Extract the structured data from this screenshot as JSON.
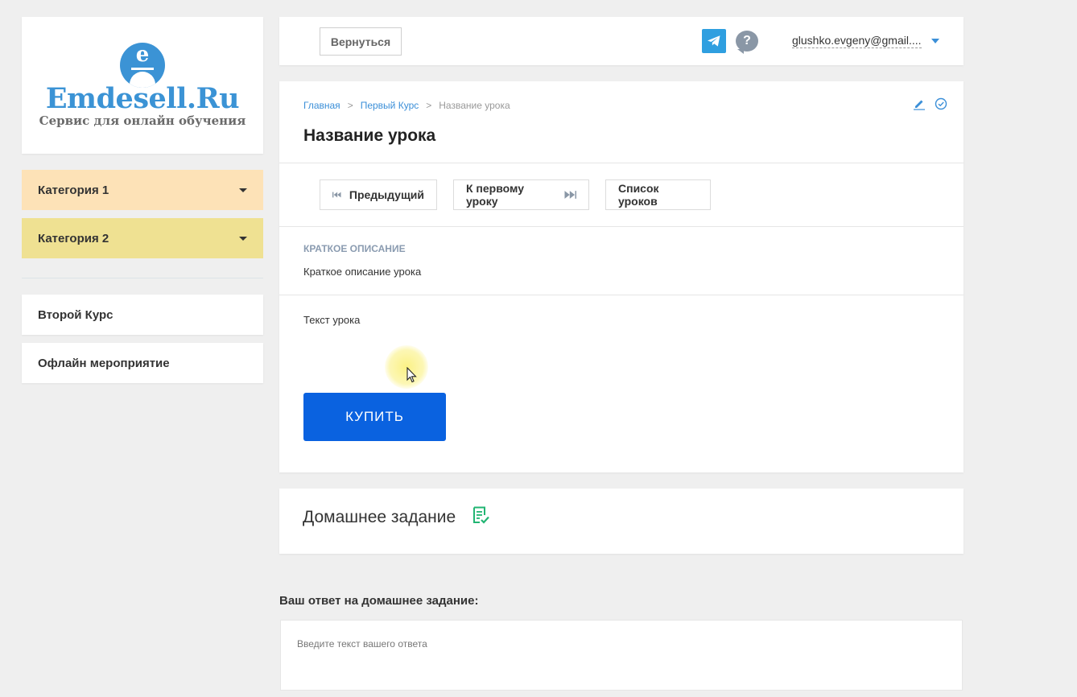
{
  "sidebar": {
    "logo": {
      "title": "Emdesell.Ru",
      "subtitle": "Сервис для онлайн обучения",
      "letter": "e"
    },
    "categories": [
      {
        "label": "Категория 1"
      },
      {
        "label": "Категория 2"
      }
    ],
    "courses": [
      {
        "label": "Второй Курс"
      },
      {
        "label": "Офлайн мероприятие"
      }
    ]
  },
  "topbar": {
    "back_label": "Вернуться",
    "help_glyph": "?",
    "user_email": "glushko.evgeny@gmail...."
  },
  "lesson": {
    "breadcrumbs": {
      "home": "Главная",
      "course": "Первый Курс",
      "current": "Название урока",
      "separator": ">"
    },
    "title": "Название урока",
    "nav": {
      "prev": "Предыдущий",
      "first": "К первому уроку",
      "list": "Список уроков"
    },
    "short_desc_label": "Краткое описание",
    "short_desc_text": "Краткое описание урока",
    "body_text": "Текст урока",
    "buy_label": "КУПИТЬ"
  },
  "homework": {
    "title": "Домашнее задание",
    "answer_label": "Ваш ответ на домашнее задание:",
    "answer_placeholder": "Введите текст вашего ответа",
    "answer_value": ""
  },
  "colors": {
    "accent": "#0a62e0",
    "link": "#3b8fd8",
    "category1": "#fde2b7",
    "category2": "#efe192",
    "telegram": "#2f9fe0",
    "homework_icon": "#22b573"
  },
  "icons": [
    "user-logo-icon",
    "telegram-icon",
    "help-icon",
    "edit-icon",
    "check-circle-icon",
    "skip-back-icon",
    "skip-forward-icon",
    "homework-icon",
    "chevron-down-icon"
  ]
}
